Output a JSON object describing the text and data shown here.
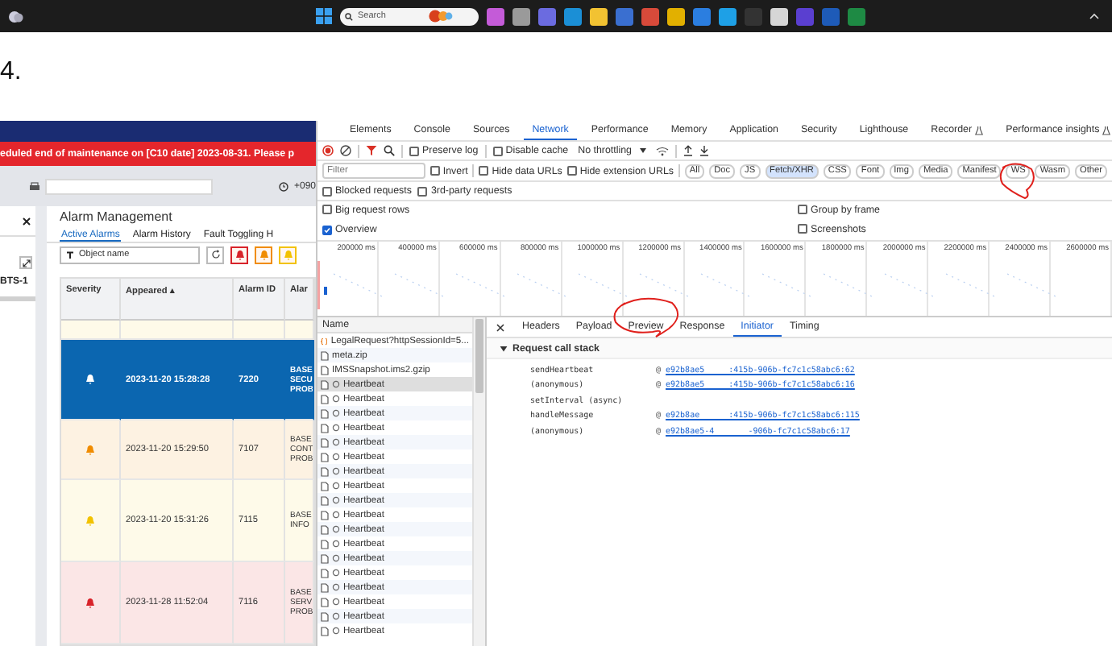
{
  "taskbar": {
    "search": {
      "placeholder": "Search"
    }
  },
  "heading": "4.",
  "app": {
    "banner": "eduled end of maintenance on [C10 date] 2023-08-31. Please p",
    "phone": "+090",
    "side_panel": {
      "label": "BTS-1"
    },
    "panel": {
      "title": "Alarm Management",
      "tabs": [
        {
          "label": "Active Alarms",
          "selected": true
        },
        {
          "label": "Alarm History",
          "selected": false
        },
        {
          "label": "Fault Toggling H",
          "selected": false
        }
      ],
      "filter": {
        "placeholder": "Object name"
      },
      "severity_filters": [
        {
          "color": "#d8232a"
        },
        {
          "color": "#f08c00"
        },
        {
          "color": "#f2c200"
        }
      ],
      "table": {
        "columns": [
          "Severity",
          "Appeared ▴",
          "Alarm ID",
          "Alar"
        ],
        "rows": [
          {
            "selected": false
          },
          {
            "selected": true,
            "appeared": "2023-11-20 15:28:28",
            "alarm_id": "7220",
            "text": [
              "BASE",
              "SECU",
              "PROB"
            ]
          },
          {
            "color": "#f08c00",
            "selected": false,
            "appeared": "2023-11-20 15:29:50",
            "alarm_id": "7107",
            "text": [
              "BASE",
              "CONT",
              "PROB"
            ]
          },
          {
            "color": "#f2c200",
            "selected": false,
            "appeared": "2023-11-20 15:31:26",
            "alarm_id": "7115",
            "text": [
              "BASE",
              "INFO"
            ]
          },
          {
            "color": "#d8232a",
            "selected": false,
            "appeared": "2023-11-28 11:52:04",
            "alarm_id": "7116",
            "text": [
              "BASE",
              "SERV",
              "PROB"
            ]
          }
        ]
      }
    }
  },
  "devtools": {
    "tabs": [
      {
        "label": "Elements",
        "selected": false,
        "experimental": false
      },
      {
        "label": "Console",
        "selected": false,
        "experimental": false
      },
      {
        "label": "Sources",
        "selected": false,
        "experimental": false
      },
      {
        "label": "Network",
        "selected": true,
        "experimental": false
      },
      {
        "label": "Performance",
        "selected": false,
        "experimental": false
      },
      {
        "label": "Memory",
        "selected": false,
        "experimental": false
      },
      {
        "label": "Application",
        "selected": false,
        "experimental": false
      },
      {
        "label": "Security",
        "selected": false,
        "experimental": false
      },
      {
        "label": "Lighthouse",
        "selected": false,
        "experimental": false
      },
      {
        "label": "Recorder",
        "selected": false,
        "experimental": true
      },
      {
        "label": "Performance insights",
        "selected": false,
        "experimental": true
      }
    ],
    "toolbar": {
      "recording": true,
      "preserve_log": {
        "label": "Preserve log",
        "checked": false
      },
      "disable_cache": {
        "label": "Disable cache",
        "checked": false
      },
      "throttling": "No throttling"
    },
    "filter": {
      "placeholder": "Filter",
      "invert": false,
      "hide_data_urls": false,
      "hide_extension_urls": false,
      "labels": [
        "Invert",
        "Hide data URLs",
        "Hide extension URLs"
      ],
      "types": [
        {
          "label": "All",
          "selected": false,
          "circled": false
        },
        {
          "label": "Doc",
          "selected": false,
          "circled": false
        },
        {
          "label": "JS",
          "selected": false,
          "circled": false
        },
        {
          "label": "Fetch/XHR",
          "selected": true,
          "circled": false
        },
        {
          "label": "CSS",
          "selected": false,
          "circled": false
        },
        {
          "label": "Font",
          "selected": false,
          "circled": false
        },
        {
          "label": "Img",
          "selected": false,
          "circled": false
        },
        {
          "label": "Media",
          "selected": false,
          "circled": false
        },
        {
          "label": "Manifest",
          "selected": false,
          "circled": false
        },
        {
          "label": "WS",
          "selected": false,
          "circled": true
        },
        {
          "label": "Wasm",
          "selected": false,
          "circled": false
        },
        {
          "label": "Other",
          "selected": false,
          "circled": false
        }
      ],
      "options": [
        {
          "label": "Blocked requests",
          "checked": false
        },
        {
          "label": "3rd-party requests",
          "checked": false
        }
      ]
    },
    "settings": [
      {
        "label": "Big request rows",
        "checked": false
      },
      {
        "label": "Group by frame",
        "checked": false
      },
      {
        "label": "Overview",
        "checked": true
      },
      {
        "label": "Screenshots",
        "checked": false
      }
    ],
    "timeline": {
      "ticks": [
        "200000 ms",
        "400000 ms",
        "600000 ms",
        "800000 ms",
        "1000000 ms",
        "1200000 ms",
        "1400000 ms",
        "1600000 ms",
        "1800000 ms",
        "2000000 ms",
        "2200000 ms",
        "2400000 ms",
        "2600000 ms"
      ]
    },
    "requests": {
      "column": "Name",
      "rows": [
        {
          "name": "LegalRequest?httpSessionId=5...",
          "kind": "fetch",
          "selected": false
        },
        {
          "name": "meta.zip",
          "kind": "file",
          "selected": false
        },
        {
          "name": "IMSSnapshot.ims2.gzip",
          "kind": "file",
          "selected": false
        },
        {
          "name": "Heartbeat",
          "kind": "websocket",
          "selected": true
        },
        {
          "name": "Heartbeat",
          "kind": "websocket",
          "selected": false
        },
        {
          "name": "Heartbeat",
          "kind": "websocket",
          "selected": false
        },
        {
          "name": "Heartbeat",
          "kind": "websocket",
          "selected": false
        },
        {
          "name": "Heartbeat",
          "kind": "websocket",
          "selected": false
        },
        {
          "name": "Heartbeat",
          "kind": "websocket",
          "selected": false
        },
        {
          "name": "Heartbeat",
          "kind": "websocket",
          "selected": false
        },
        {
          "name": "Heartbeat",
          "kind": "websocket",
          "selected": false
        },
        {
          "name": "Heartbeat",
          "kind": "websocket",
          "selected": false
        },
        {
          "name": "Heartbeat",
          "kind": "websocket",
          "selected": false
        },
        {
          "name": "Heartbeat",
          "kind": "websocket",
          "selected": false
        },
        {
          "name": "Heartbeat",
          "kind": "websocket",
          "selected": false
        },
        {
          "name": "Heartbeat",
          "kind": "websocket",
          "selected": false
        },
        {
          "name": "Heartbeat",
          "kind": "websocket",
          "selected": false
        },
        {
          "name": "Heartbeat",
          "kind": "websocket",
          "selected": false
        },
        {
          "name": "Heartbeat",
          "kind": "websocket",
          "selected": false
        },
        {
          "name": "Heartbeat",
          "kind": "websocket",
          "selected": false
        },
        {
          "name": "Heartbeat",
          "kind": "websocket",
          "selected": false
        }
      ]
    },
    "details": {
      "tabs": [
        {
          "label": "Headers",
          "selected": false,
          "circled": false
        },
        {
          "label": "Payload",
          "selected": false,
          "circled": false
        },
        {
          "label": "Preview",
          "selected": false,
          "circled": true
        },
        {
          "label": "Response",
          "selected": false,
          "circled": false
        },
        {
          "label": "Initiator",
          "selected": true,
          "circled": false
        },
        {
          "label": "Timing",
          "selected": false,
          "circled": false
        }
      ],
      "section": {
        "title": "Request call stack",
        "expanded": true
      },
      "frames": [
        {
          "kind": "call",
          "function": "sendHeartbeat",
          "at": "@",
          "location": "e92b8ae5_____:415b-906b-fc7c1c58abc6:62"
        },
        {
          "kind": "call",
          "function": "(anonymous)",
          "at": "@",
          "location": "e92b8ae5_____:415b-906b-fc7c1c58abc6:16"
        },
        {
          "kind": "async",
          "function": "setInterval (async)"
        },
        {
          "kind": "call",
          "function": "handleMessage",
          "at": "@",
          "location": "e92b8ae______:415b-906b-fc7c1c58abc6:115"
        },
        {
          "kind": "call",
          "function": "(anonymous)",
          "at": "@",
          "location": "e92b8ae5-4_______-906b-fc7c1c58abc6:17"
        }
      ]
    }
  }
}
